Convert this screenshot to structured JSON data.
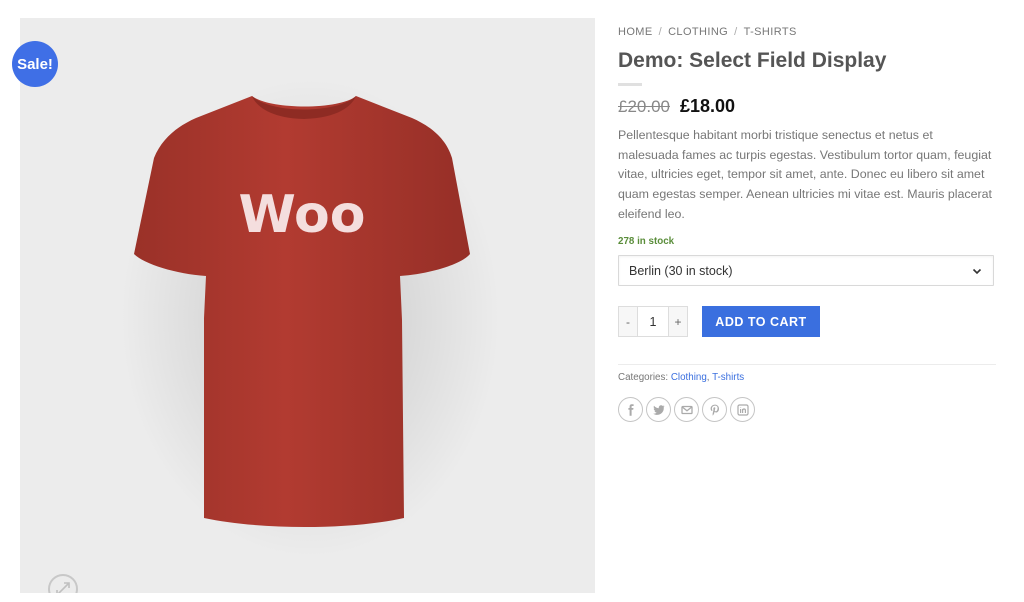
{
  "badge": {
    "sale_label": "Sale!"
  },
  "image": {
    "print_text": "Woo",
    "shirt_color": "#b03a30",
    "background": "#ececec"
  },
  "breadcrumb": {
    "items": [
      "HOME",
      "CLOTHING",
      "T-SHIRTS"
    ],
    "separator": "/"
  },
  "product": {
    "title": "Demo: Select Field Display",
    "price_old": "£20.00",
    "price_new": "£18.00",
    "description": "Pellentesque habitant morbi tristique senectus et netus et malesuada fames ac turpis egestas. Vestibulum tortor quam, feugiat vitae, ultricies eget, tempor sit amet, ante. Donec eu libero sit amet quam egestas semper. Aenean ultricies mi vitae est. Mauris placerat eleifend leo.",
    "stock": "278 in stock"
  },
  "variation": {
    "selected": "Berlin (30 in stock)"
  },
  "cart": {
    "qty_minus": "-",
    "qty_value": "1",
    "qty_plus": "+",
    "button_label": "ADD TO CART"
  },
  "meta": {
    "categories_label": "Categories:",
    "categories": [
      "Clothing",
      "T-shirts"
    ],
    "categories_separator": ", "
  },
  "share": {
    "icons": [
      "facebook-icon",
      "twitter-icon",
      "email-icon",
      "pinterest-icon",
      "linkedin-icon"
    ]
  },
  "colors": {
    "accent": "#3a6fdf",
    "sale_badge": "#3f6fe6",
    "in_stock": "#5a8d3a"
  }
}
